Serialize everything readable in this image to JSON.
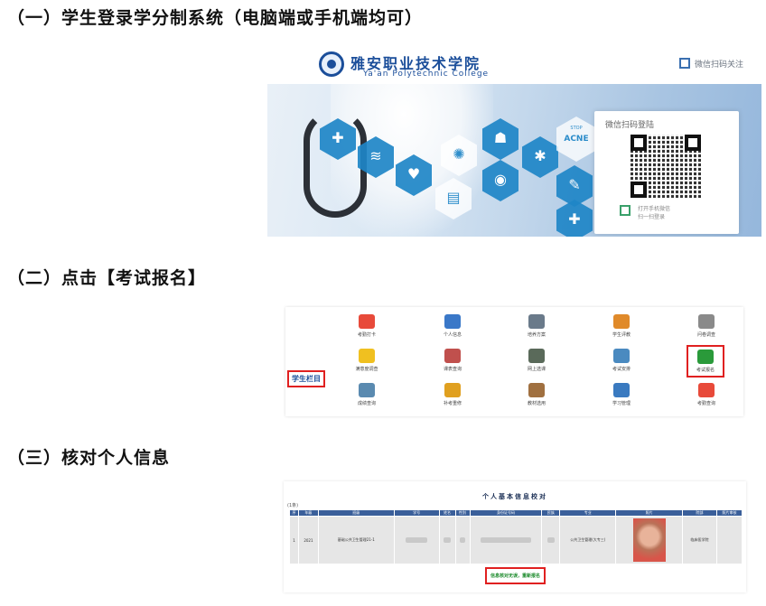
{
  "headings": {
    "step1": "（一）学生登录学分制系统（电脑端或手机端均可）",
    "step2": "（二）点击【考试报名】",
    "step3": "（三）核对个人信息"
  },
  "login": {
    "school_cn": "雅安职业技术学院",
    "school_en": "Ya'an Polytechnic College",
    "wechat_follow": "微信扫码关注",
    "qr_title": "微信扫码登陆",
    "qr_tip_line1": "打开手机微信",
    "qr_tip_line2": "扫一扫登录",
    "hex_acne": "ACNE",
    "hex_stop": "STOP"
  },
  "menu": {
    "side_label": "学生栏目",
    "items": [
      {
        "label": "考勤打卡",
        "color": "#e84a3a"
      },
      {
        "label": "个人信息",
        "color": "#3a78c8"
      },
      {
        "label": "培养方案",
        "color": "#6a7a8a"
      },
      {
        "label": "学生评教",
        "color": "#e08a2a"
      },
      {
        "label": "问卷调查",
        "color": "#8a8a8a"
      },
      {
        "label": "满意度调查",
        "color": "#f0c020"
      },
      {
        "label": "课表查询",
        "color": "#c0504d"
      },
      {
        "label": "网上选课",
        "color": "#5a6a5a"
      },
      {
        "label": "考试安排",
        "color": "#4a8ac0"
      },
      {
        "label": "考试报名",
        "color": "#2a9a3a"
      },
      {
        "label": "成绩查询",
        "color": "#5a8ab0"
      },
      {
        "label": "补考重修",
        "color": "#e0a020"
      },
      {
        "label": "教材选用",
        "color": "#a07040"
      },
      {
        "label": "学习管理",
        "color": "#3a7ac0"
      },
      {
        "label": "考勤查询",
        "color": "#e84a3a"
      }
    ]
  },
  "info": {
    "title": "个人基本信息校对",
    "count": "(1条)",
    "columns": [
      "序",
      "年级",
      "班级",
      "学号",
      "姓名",
      "性别",
      "身份证号码",
      "民族",
      "专业",
      "照片",
      "院部",
      "照片审核"
    ],
    "row": {
      "index": "1",
      "grade": "2021",
      "class": "基础公共卫生管理21-1",
      "major": "公共卫生管理(大专三)",
      "department": "临床医学院"
    },
    "confirm_button": "信息核对无误，重新报名"
  }
}
